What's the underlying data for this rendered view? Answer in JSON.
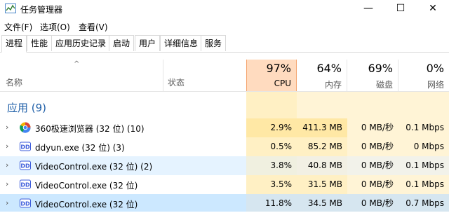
{
  "window": {
    "title": "任务管理器",
    "controls": {
      "minimize": "—",
      "maximize": "☐",
      "close": "✕"
    }
  },
  "menu": [
    "文件(F)",
    "选项(O)",
    "查看(V)"
  ],
  "tabs": [
    "进程",
    "性能",
    "应用历史记录",
    "启动",
    "用户",
    "详细信息",
    "服务"
  ],
  "columns": {
    "sort_indicator": "^",
    "name": "名称",
    "status": "状态",
    "cpu": {
      "percent": "97%",
      "label": "CPU"
    },
    "memory": {
      "percent": "64%",
      "label": "内存"
    },
    "disk": {
      "percent": "69%",
      "label": "磁盘"
    },
    "network": {
      "percent": "0%",
      "label": "网络"
    }
  },
  "group": {
    "label": "应用 (9)"
  },
  "rows": [
    {
      "name": "360极速浏览器 (32 位) (10)",
      "cpu": "2.9%",
      "memory": "411.3 MB",
      "disk": "0 MB/秒",
      "network": "0.1 Mbps",
      "icon": "browser-icon"
    },
    {
      "name": "ddyun.exe (32 位) (3)",
      "cpu": "0.5%",
      "memory": "85.2 MB",
      "disk": "0 MB/秒",
      "network": "0 Mbps",
      "icon": "dd-app-icon"
    },
    {
      "name": "VideoControl.exe (32 位) (2)",
      "cpu": "3.8%",
      "memory": "40.8 MB",
      "disk": "0 MB/秒",
      "network": "0.1 Mbps",
      "icon": "dd-app-icon"
    },
    {
      "name": "VideoControl.exe (32 位)",
      "cpu": "3.5%",
      "memory": "31.5 MB",
      "disk": "0 MB/秒",
      "network": "0.1 Mbps",
      "icon": "dd-app-icon"
    },
    {
      "name": "VideoControl.exe (32 位)",
      "cpu": "11.8%",
      "memory": "34.5 MB",
      "disk": "0 MB/秒",
      "network": "0.7 Mbps",
      "icon": "dd-app-icon"
    }
  ],
  "colors": {
    "accent": "#1f5fa8",
    "cpu_header": "#ffdbbf",
    "cell_heat": "#fff0c4",
    "selected_row": "#cce8ff"
  }
}
